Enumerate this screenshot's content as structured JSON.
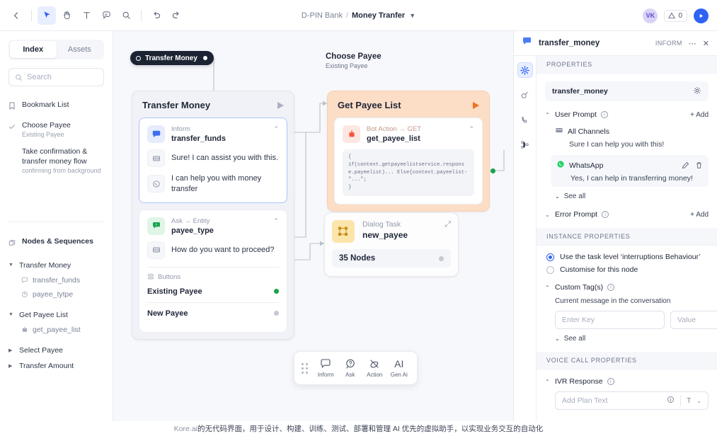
{
  "topbar": {
    "back_icon": "chevron-left-icon",
    "tools": [
      {
        "name": "pointer-tool",
        "glyph": "pointer",
        "active": true
      },
      {
        "name": "hand-tool",
        "glyph": "hand",
        "active": false
      },
      {
        "name": "text-tool",
        "glyph": "T",
        "active": false
      },
      {
        "name": "comment-tool",
        "glyph": "comment",
        "active": false
      },
      {
        "name": "zoom-tool",
        "glyph": "search",
        "active": false
      }
    ],
    "undo_label": "undo",
    "redo_label": "redo",
    "breadcrumb_app": "D-PIN Bank",
    "breadcrumb_sep": "/",
    "breadcrumb_task": "Money Tranfer",
    "avatar_initials": "VK",
    "warning_count": "0",
    "run_label": "run"
  },
  "sidebar": {
    "tabs": [
      {
        "label": "Index",
        "active": true
      },
      {
        "label": "Assets",
        "active": false
      }
    ],
    "search_placeholder": "Search",
    "items": [
      {
        "icon": "bookmark-icon",
        "label": "Bookmark List",
        "sub": ""
      },
      {
        "icon": "check-icon",
        "label": "Choose Payee",
        "sub": "Existing Payee"
      },
      {
        "icon": "",
        "label": "Take confirmation & transfer money flow",
        "sub": "confirming from background"
      }
    ],
    "section_label": "Nodes & Sequences",
    "section_icon": "layers-icon",
    "groups": [
      {
        "label": "Transfer Money",
        "expanded": true,
        "children": [
          {
            "icon": "message-icon",
            "label": "transfer_funds"
          },
          {
            "icon": "question-icon",
            "label": "payee_tytpe"
          }
        ]
      },
      {
        "label": "Get Payee List",
        "expanded": true,
        "children": [
          {
            "icon": "bot-icon",
            "label": "get_payee_list"
          }
        ]
      },
      {
        "label": "Select Payee",
        "expanded": false,
        "children": []
      },
      {
        "label": "Transfer Amount",
        "expanded": false,
        "children": []
      }
    ]
  },
  "canvas": {
    "start_pill": "Transfer Money",
    "group_title": "Choose Payee",
    "group_subtitle": "Existing Payee",
    "transfer_money_node": {
      "title": "Transfer Money",
      "inform": {
        "kind": "Inform",
        "name": "transfer_funds",
        "icon": "message-icon",
        "messages": [
          {
            "icon": "channel-icon",
            "text": "Sure! I can assist you with this."
          },
          {
            "icon": "whatsapp-icon",
            "text": "I can help you with money transfer"
          }
        ]
      },
      "ask": {
        "kind": "Ask → Entity",
        "name": "payee_type",
        "icon": "ask-icon",
        "messages": [
          {
            "icon": "channel-icon",
            "text": "How do you want to proceed?"
          }
        ],
        "buttons_label": "Buttons",
        "buttons": [
          {
            "label": "Existing Payee",
            "state": "green"
          },
          {
            "label": "New Payee",
            "state": "grey"
          }
        ]
      }
    },
    "get_payee_list_node": {
      "title": "Get Payee List",
      "kind": "Bot Action → GET",
      "name": "get_payee_list",
      "icon": "bot-icon",
      "code": "{\nif(context.getpayeelistservice.response.payeelist)... Else{context.payeelist-\"...\";\n}"
    },
    "dialog_task_node": {
      "kind": "Dialog Task",
      "name": "new_payee",
      "icon": "dialog-icon",
      "nodes_count": "35 Nodes",
      "expand_icon": "expand-icon"
    },
    "floatbar": [
      {
        "label": "Inform",
        "icon": "message-icon"
      },
      {
        "label": "Ask",
        "icon": "question-icon"
      },
      {
        "label": "Action",
        "icon": "action-icon"
      },
      {
        "label": "Gen Ai",
        "icon": "AI"
      }
    ]
  },
  "rightpanel": {
    "header": {
      "icon": "message-icon",
      "title": "transfer_money",
      "kind": "INFORM",
      "more_icon": "more-icon",
      "close_icon": "close-icon"
    },
    "rail": [
      {
        "name": "settings-icon",
        "active": true
      },
      {
        "name": "connections-icon",
        "active": false
      },
      {
        "name": "phone-icon",
        "active": false
      },
      {
        "name": "flow-icon",
        "active": false
      }
    ],
    "properties_label": "PROPERTIES",
    "node_name": "transfer_money",
    "node_settings_icon": "gear-icon",
    "user_prompt": {
      "label": "User Prompt",
      "add_label": "+ Add",
      "items": [
        {
          "channel": "All Channels",
          "icon": "channel-icon",
          "text": "Sure I can help you with this!",
          "highlight": false
        },
        {
          "channel": "WhatsApp",
          "icon": "whatsapp-icon",
          "text": "Yes, I can help in transferring money!",
          "highlight": true
        }
      ],
      "see_all": "See all"
    },
    "error_prompt": {
      "label": "Error Prompt",
      "add_label": "+ Add"
    },
    "instance_label": "INSTANCE PROPERTIES",
    "radios": [
      {
        "label": "Use the task level ‘interruptions Behaviour’",
        "selected": true
      },
      {
        "label": "Customise for this node",
        "selected": false
      }
    ],
    "custom_tags": {
      "label": "Custom Tag(s)",
      "help": "Current message in the conversation",
      "key_placeholder": "Enter Key",
      "value_placeholder": "Value",
      "see_all": "See all"
    },
    "voice_label": "VOICE CALL PROPERTIES",
    "ivr": {
      "label": "IVR Response",
      "placeholder": "Add Plan Text",
      "info_icon": "info-icon",
      "text_icon": "T",
      "caret_icon": "chevron-down-icon"
    }
  },
  "caption": {
    "brand": "Kore.ai",
    "text": " 的无代码界面，用于设计、构建、训练、测试、部署和管理 AI 优先的虚拟助手，以实现业务交互的自动化"
  }
}
